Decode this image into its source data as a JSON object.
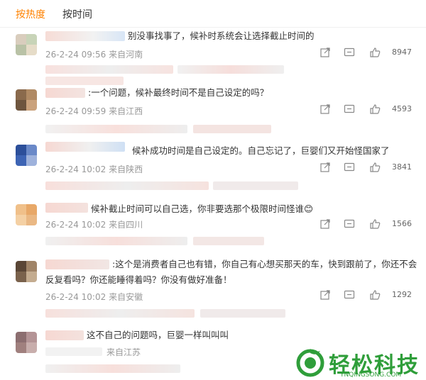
{
  "tabs": {
    "hot": "按热度",
    "time": "按时间"
  },
  "colors": {
    "accent": "#ff8200",
    "meta": "#999999",
    "watermark": "#2f9e3a"
  },
  "comments": [
    {
      "text": "别没事找事了，候补时系统会让选择截止时间的",
      "date": "26-2-24 09:56",
      "location": "来自河南",
      "likes": "8947"
    },
    {
      "text": ":一个问题，候补最终时间不是自己设定的吗？",
      "date": "26-2-24 09:59",
      "location": "来自江西",
      "likes": "4593"
    },
    {
      "text": "候补成功时间是自己设定的。自己忘记了，巨婴们又开始怪国家了",
      "date": "26-2-24 10:02",
      "location": "来自陕西",
      "likes": "3841"
    },
    {
      "text": "候补截止时间可以自己选，你非要选那个极限时间怪谁😊",
      "date": "26-2-24 10:02",
      "location": "来自四川",
      "likes": "1566"
    },
    {
      "text_line1": ":这个是消费者自己也有错，你自己有心想买那天的车，快到跟前了，你还不会",
      "text_line2": "反复看吗？你还能睡得着吗？你没有做好准备！",
      "date": "26-2-24 10:02",
      "location": "来自安徽",
      "likes": "1292"
    },
    {
      "text": "这不自己的问题吗，巨婴一样叫叫叫",
      "date": "",
      "location": "来自江苏",
      "likes": ""
    }
  ],
  "icons": [
    "share-icon",
    "comment-icon",
    "like-icon"
  ],
  "watermark": {
    "title": "轻松科技",
    "subtitle": "YNQINGSONG.COM"
  }
}
